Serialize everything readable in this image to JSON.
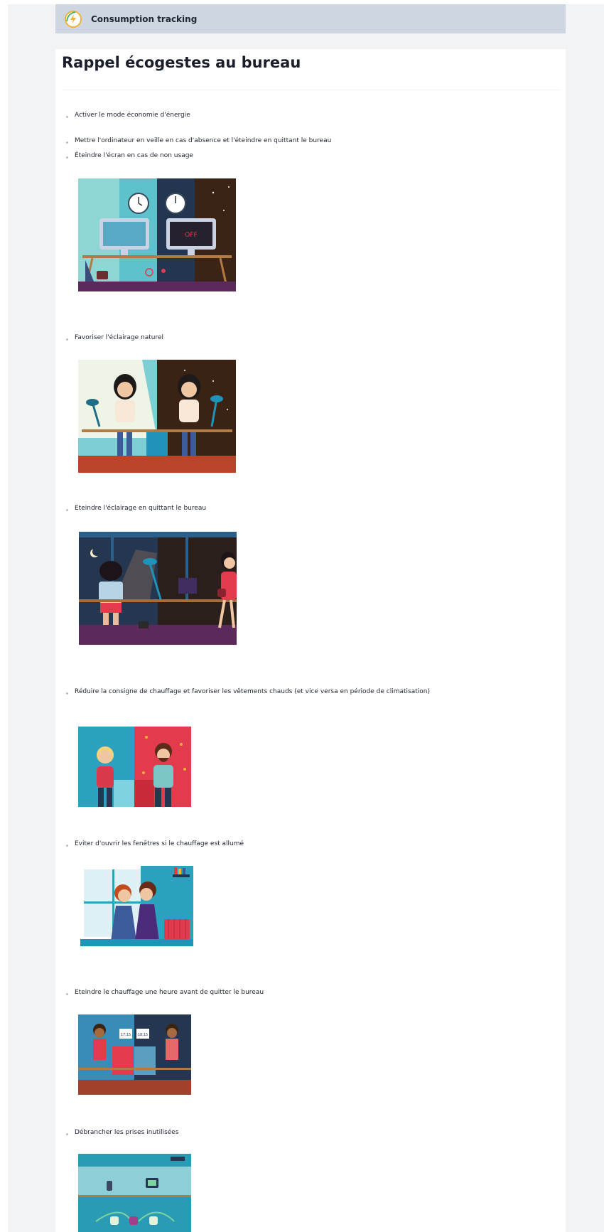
{
  "header": {
    "app_title": "Consumption tracking",
    "logo_icon": "lightning-leaf-icon"
  },
  "page": {
    "title": "Rappel écogestes au bureau"
  },
  "tips": [
    {
      "label": "Activer le mode économie d'énergie"
    },
    {
      "label": "Mettre l'ordinateur en veille en cas d'absence et l'éteindre en quittant le bureau"
    },
    {
      "label": "Éteindre l'écran en cas de non usage",
      "screen_text": "OFF"
    },
    {
      "label": "Favoriser l'éclairage naturel"
    },
    {
      "label": "Eteindre l'éclairage en quittant le bureau"
    },
    {
      "label": "Réduire la consigne de chauffage et favoriser les vêtements chauds (et vice versa en période de climatisation)"
    },
    {
      "label": "Eviter d'ouvrir les fenêtres si le chauffage est allumé"
    },
    {
      "label": "Eteindre le chauffage une heure avant de quitter le bureau",
      "clock_left": "17:15",
      "clock_right": "18:15"
    },
    {
      "label": "Débrancher les prises inutilisées"
    }
  ],
  "colors": {
    "header_bg": "#cdd6e1",
    "page_bg": "#f2f3f5",
    "card_bg": "#ffffff",
    "accent_red": "#e23b4e",
    "accent_teal": "#3fb5c7"
  }
}
